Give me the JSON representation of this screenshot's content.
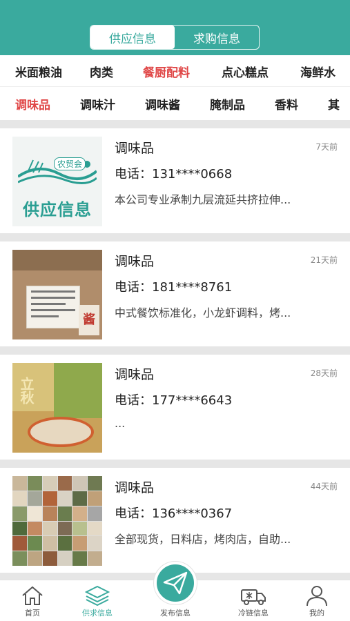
{
  "header": {
    "tabs": [
      {
        "label": "供应信息",
        "active": true
      },
      {
        "label": "求购信息",
        "active": false
      }
    ],
    "accent_color": "#3aaa9e"
  },
  "categories": [
    {
      "label": "米面粮油",
      "active": false
    },
    {
      "label": "肉类",
      "active": false
    },
    {
      "label": "餐厨配料",
      "active": true
    },
    {
      "label": "点心糕点",
      "active": false
    },
    {
      "label": "海鲜水",
      "active": false
    }
  ],
  "subcategories": [
    {
      "label": "调味品",
      "active": true
    },
    {
      "label": "调味汁",
      "active": false
    },
    {
      "label": "调味酱",
      "active": false
    },
    {
      "label": "腌制品",
      "active": false
    },
    {
      "label": "香料",
      "active": false
    },
    {
      "label": "其",
      "active": false
    }
  ],
  "listings": [
    {
      "title": "调味品",
      "time": "7天前",
      "phone": "电话：131****0668",
      "desc": "本公司专业承制九层流延共挤拉伸...",
      "image": {
        "logo_text": "农贸会",
        "big_text": "供应信息"
      }
    },
    {
      "title": "调味品",
      "time": "21天前",
      "phone": "电话：181****8761",
      "desc": "中式餐饮标准化，小龙虾调料，烤...",
      "image": {
        "seal_text": "酱料"
      }
    },
    {
      "title": "调味品",
      "time": "28天前",
      "phone": "电话：177****6643",
      "desc": "...",
      "image": {
        "tag_text": "立秋"
      }
    },
    {
      "title": "调味品",
      "time": "44天前",
      "phone": "电话：136****0367",
      "desc": "全部现货，日料店，烤肉店，自助...",
      "image": {}
    }
  ],
  "tabbar": {
    "items": [
      {
        "label": "首页",
        "icon": "home-icon",
        "active": false
      },
      {
        "label": "供求信息",
        "icon": "layers-icon",
        "active": true
      },
      {
        "label": "发布信息",
        "icon": "paper-plane-icon",
        "active": false
      },
      {
        "label": "冷链信息",
        "icon": "truck-icon",
        "active": false
      },
      {
        "label": "我的",
        "icon": "user-icon",
        "active": false
      }
    ]
  }
}
